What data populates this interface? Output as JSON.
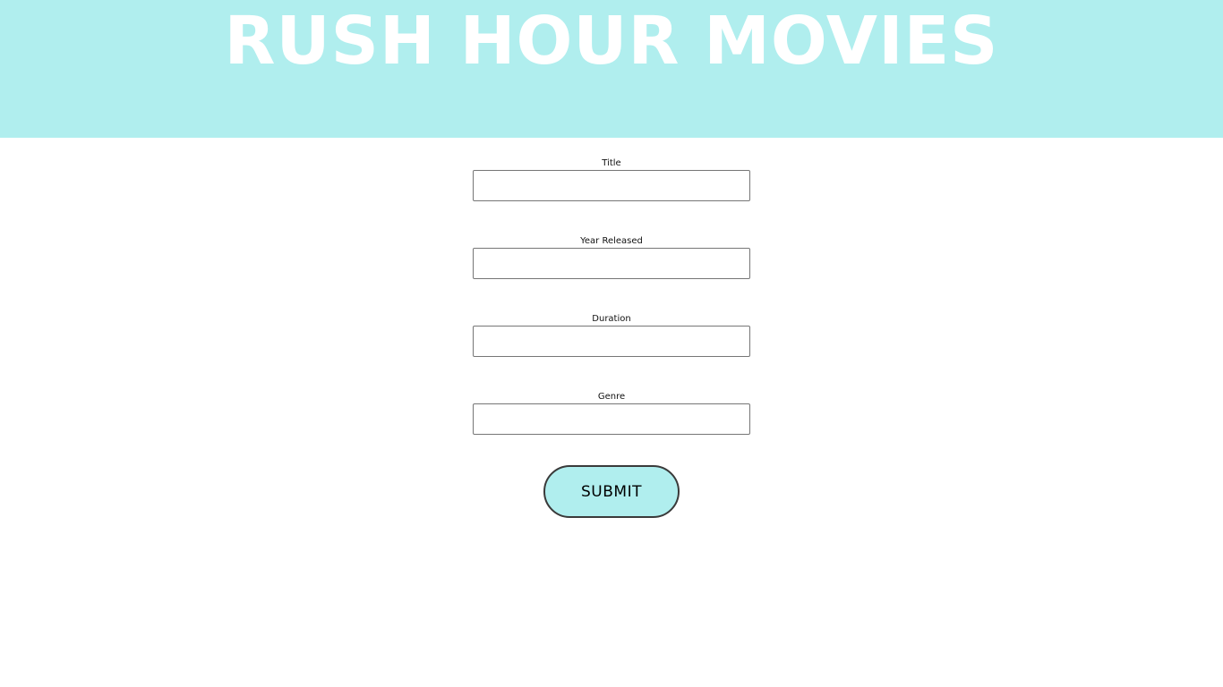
{
  "header": {
    "title": "RUSH HOUR MOVIES",
    "background": "#b0eeee"
  },
  "form": {
    "fields": [
      {
        "label": "Title",
        "value": ""
      },
      {
        "label": "Year Released",
        "value": ""
      },
      {
        "label": "Duration",
        "value": ""
      },
      {
        "label": "Genre",
        "value": ""
      }
    ],
    "submit_label": "SUBMIT",
    "submit_color": "#b0eeee"
  }
}
